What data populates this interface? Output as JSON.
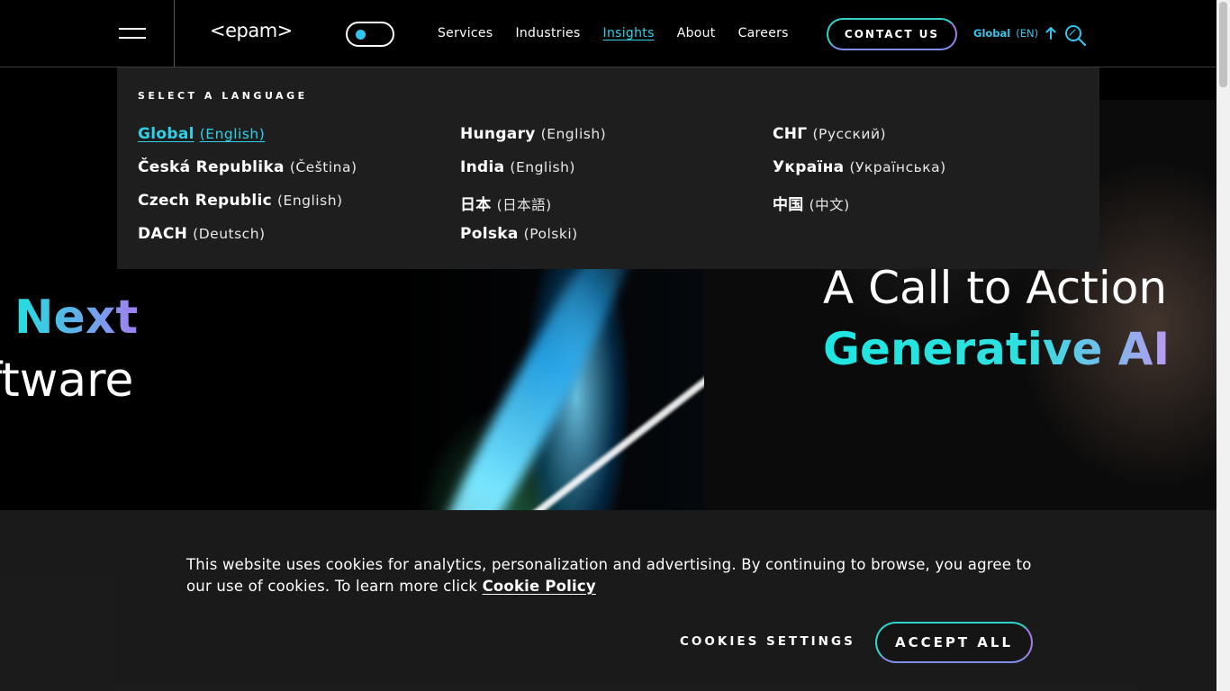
{
  "header": {
    "logo": "<epam>",
    "nav": [
      {
        "label": "Services",
        "active": false
      },
      {
        "label": "Industries",
        "active": false
      },
      {
        "label": "Insights",
        "active": true
      },
      {
        "label": "About",
        "active": false
      },
      {
        "label": "Careers",
        "active": false
      }
    ],
    "contact_label": "CONTACT US",
    "lang_region": "Global",
    "lang_code": "(EN)"
  },
  "lang_panel": {
    "title": "SELECT A LANGUAGE",
    "columns": [
      [
        {
          "region": "Global",
          "language": "(English)",
          "active": true
        },
        {
          "region": "Česká Republika",
          "language": "(Čeština)"
        },
        {
          "region": "Czech Republic",
          "language": "(English)"
        },
        {
          "region": "DACH",
          "language": "(Deutsch)"
        }
      ],
      [
        {
          "region": "Hungary",
          "language": "(English)"
        },
        {
          "region": "India",
          "language": "(English)"
        },
        {
          "region": "日本",
          "language": "(日本語)"
        },
        {
          "region": "Polska",
          "language": "(Polski)"
        }
      ],
      [
        {
          "region": "СНГ",
          "language": "(Русский)"
        },
        {
          "region": "Україна",
          "language": "(Українська)"
        },
        {
          "region": "中国",
          "language": "(中文)"
        }
      ]
    ]
  },
  "hero": {
    "left_line1": "Next",
    "left_line2": "ftware",
    "right_line1": "A Call to Action",
    "right_line2": "Generative AI"
  },
  "cookie": {
    "message": "This website uses cookies for analytics, personalization and advertising. By continuing to browse, you agree to our use of cookies. To learn more click ",
    "policy_link": "Cookie Policy",
    "settings_label": "COOKIES SETTINGS",
    "accept_label": "ACCEPT ALL"
  },
  "colors": {
    "accent": "#30d0e8",
    "background": "#000000",
    "panel": "#1e1e1e",
    "banner": "#1c1c1c"
  }
}
